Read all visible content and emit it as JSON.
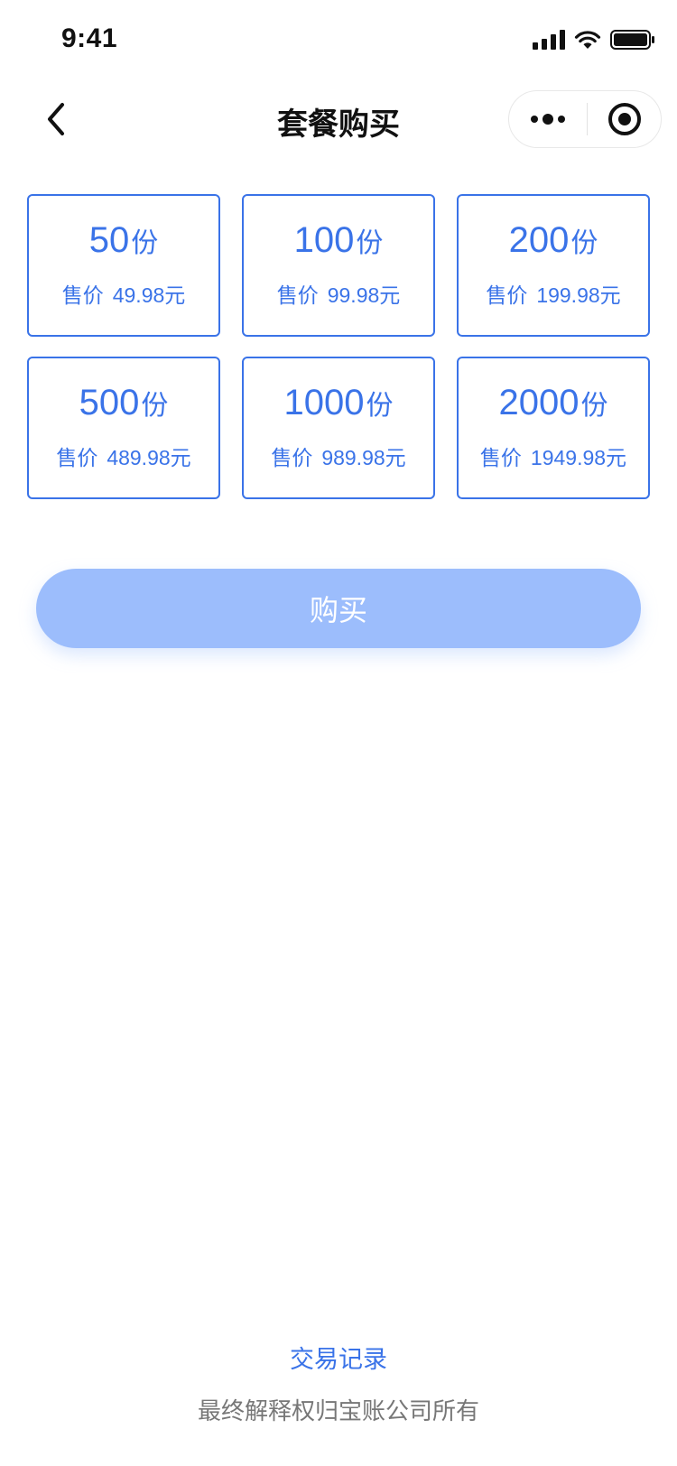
{
  "status_bar": {
    "time": "9:41"
  },
  "nav": {
    "title": "套餐购买",
    "back_icon": "chevron-left-icon",
    "more_icon": "more-dots-icon",
    "close_icon": "target-icon"
  },
  "packages": [
    {
      "quantity": "50",
      "unit": "份",
      "price_label": "售价",
      "price": "49.98元"
    },
    {
      "quantity": "100",
      "unit": "份",
      "price_label": "售价",
      "price": "99.98元"
    },
    {
      "quantity": "200",
      "unit": "份",
      "price_label": "售价",
      "price": "199.98元"
    },
    {
      "quantity": "500",
      "unit": "份",
      "price_label": "售价",
      "price": "489.98元"
    },
    {
      "quantity": "1000",
      "unit": "份",
      "price_label": "售价",
      "price": "989.98元"
    },
    {
      "quantity": "2000",
      "unit": "份",
      "price_label": "售价",
      "price": "1949.98元"
    }
  ],
  "buy_button": {
    "label": "购买"
  },
  "footer": {
    "records_link": "交易记录",
    "copyright": "最终解释权归宝账公司所有"
  },
  "colors": {
    "accent": "#3a73e8",
    "button_disabled": "#9cbdfc",
    "footer_text": "#777777"
  }
}
